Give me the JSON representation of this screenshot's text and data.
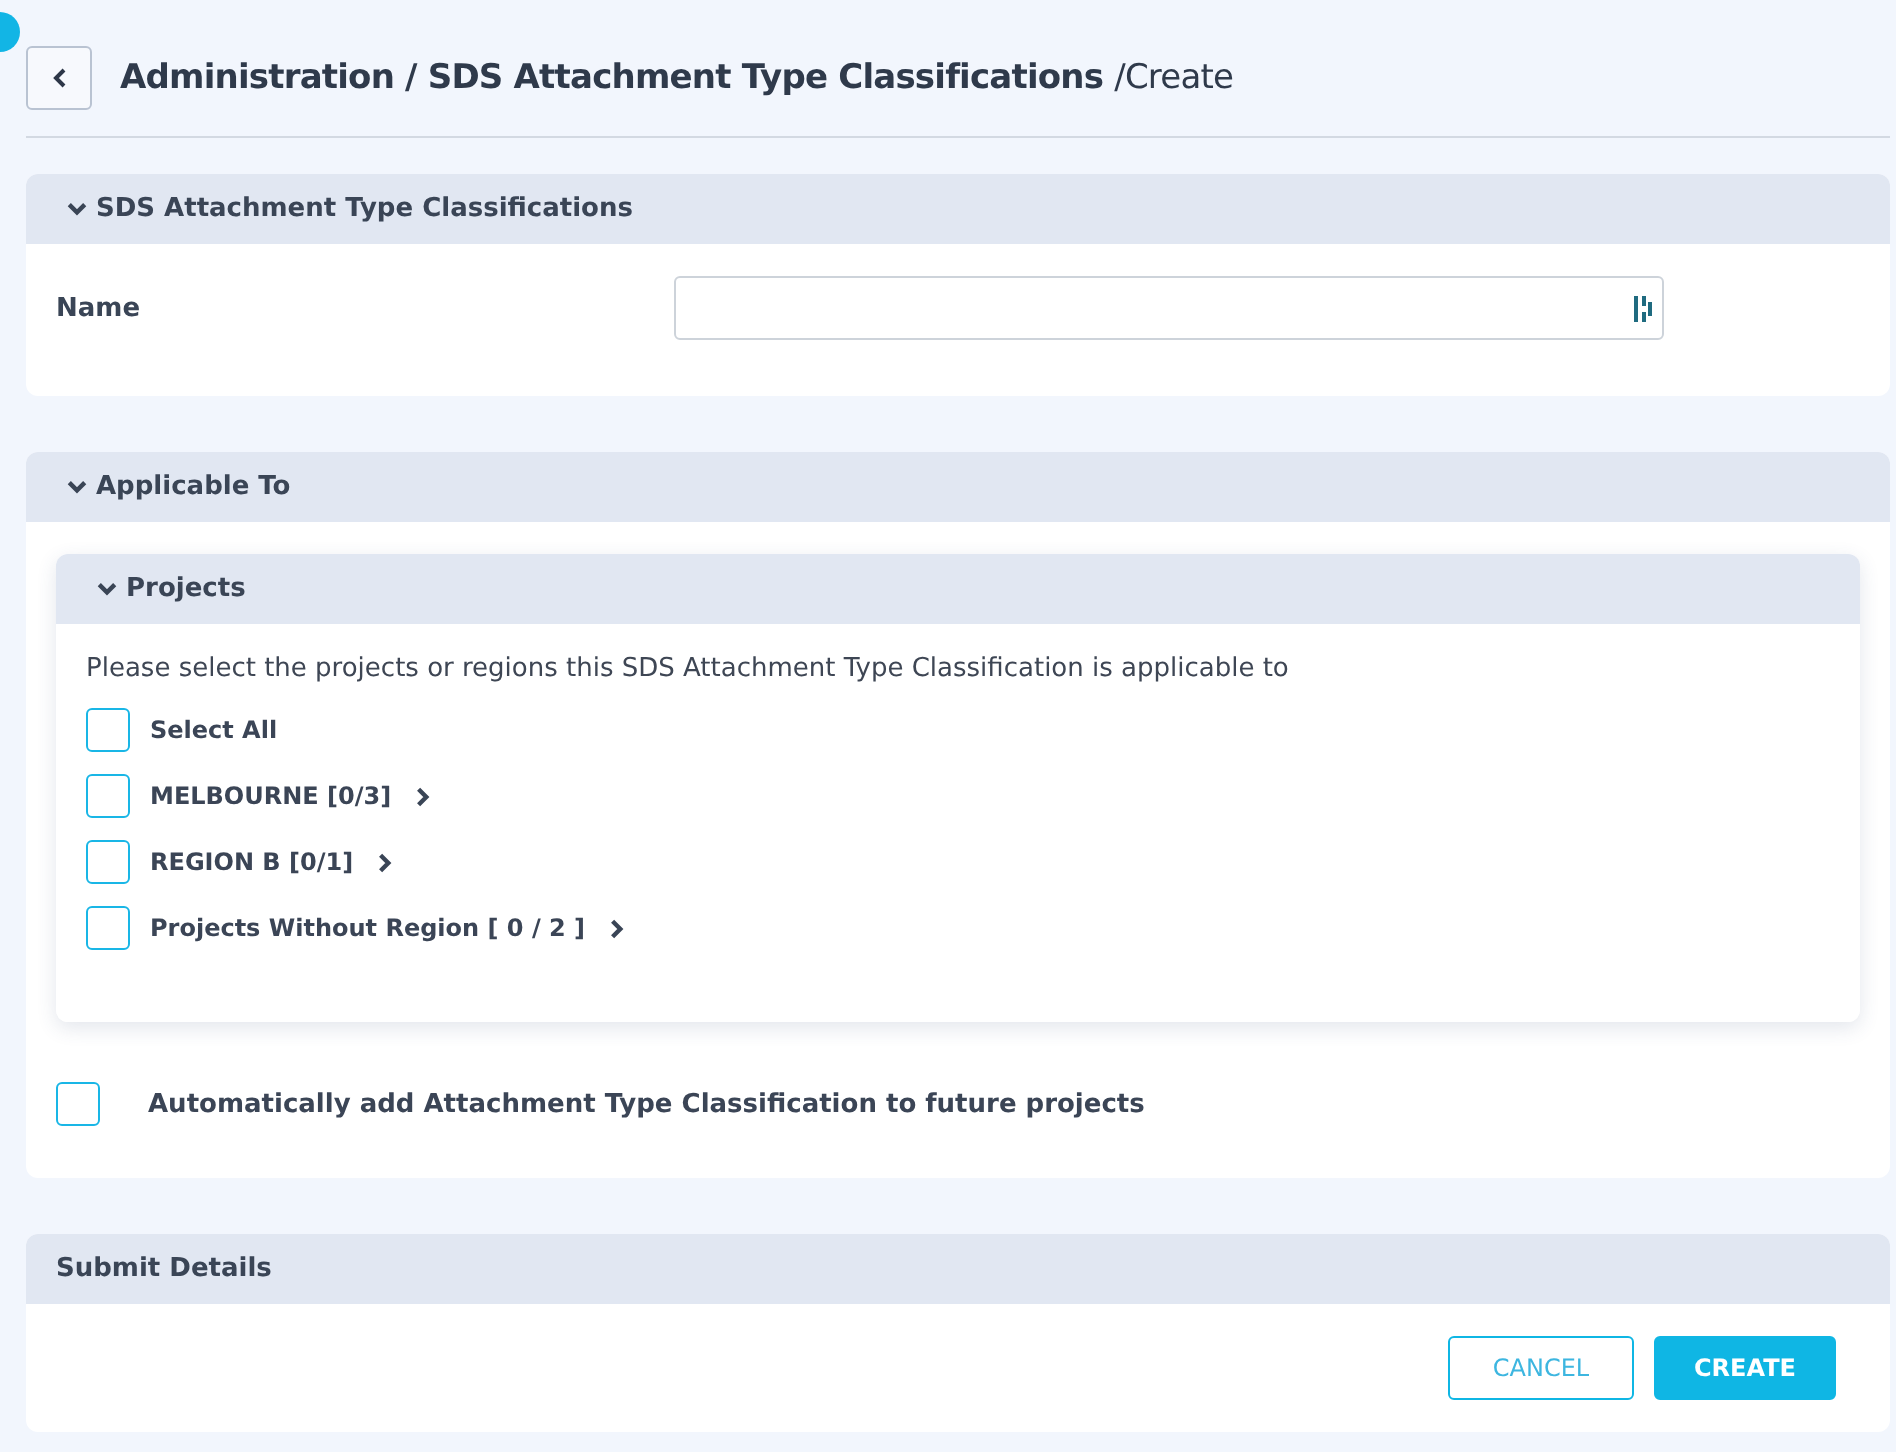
{
  "breadcrumb": {
    "path": "Administration / SDS Attachment Type Classifications",
    "current": "/Create"
  },
  "details_section": {
    "title": "SDS Attachment Type Classifications",
    "expanded": true,
    "fields": [
      {
        "label": "Name"
      }
    ]
  },
  "applicable_section": {
    "title": "Applicable To",
    "expanded": true,
    "projects": {
      "title": "Projects",
      "expanded": true,
      "instruction": "Please select the projects or regions this SDS Attachment Type Classification is applicable to",
      "options": [
        {
          "kind": "all",
          "label": "Select All",
          "checked": false
        },
        {
          "kind": "group",
          "label": "MELBOURNE [0/3]",
          "checked": false
        },
        {
          "kind": "group",
          "label": "REGION B [0/1]",
          "checked": false
        },
        {
          "kind": "group",
          "label": "Projects Without Region [ 0 / 2 ]",
          "checked": false
        }
      ]
    },
    "auto_add": {
      "label": "Automatically add Attachment Type Classification to future projects",
      "checked": false
    }
  },
  "submit_section": {
    "title": "Submit Details",
    "buttons": [
      {
        "kind": "secondary",
        "label": "CANCEL"
      },
      {
        "kind": "primary",
        "label": "CREATE"
      }
    ]
  }
}
